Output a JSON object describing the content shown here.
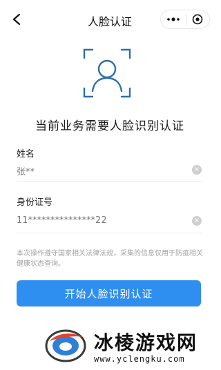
{
  "header": {
    "title": "人脸认证",
    "back_icon": "chevron-left-icon",
    "more_icon": "more-dots-icon",
    "close_icon": "target-close-icon"
  },
  "face_icon": "face-scan-icon",
  "headline": "当前业务需要人脸识别认证",
  "form": {
    "name_label": "姓名",
    "name_value": "张**",
    "id_label": "身份证号",
    "id_value": "11***************22"
  },
  "notice": "本次操作遵守国家相关法律法规，采集的信息仅用于防疫相关健康状态查询。",
  "button": {
    "start_label": "开始人脸识别认证"
  },
  "colors": {
    "accent": "#2f8ff0",
    "icon_stroke": "#2d6ea8"
  },
  "watermark": {
    "title": "冰棱游戏网",
    "url": "www.yclengku.com"
  }
}
